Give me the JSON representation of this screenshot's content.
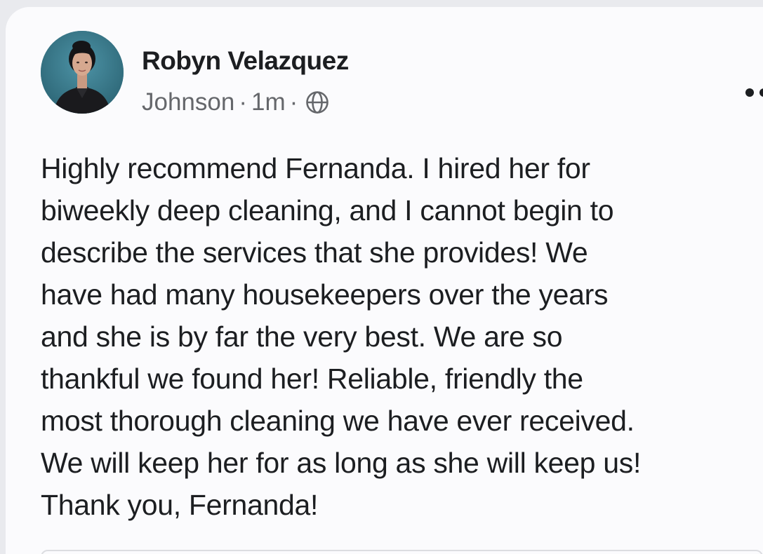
{
  "post": {
    "author": "Robyn Velazquez",
    "group": "Johnson",
    "separator": "·",
    "time": "1m",
    "privacy_icon": "globe-icon",
    "more_icon": "more-options-icon",
    "body_lines": [
      "Highly recommend Fernanda. I hired her for",
      "biweekly deep cleaning, and I cannot begin to",
      "describe the services that she provides! We",
      "have had many housekeepers over the years",
      "and she is by far the very best. We are so",
      "thankful we found her! Reliable, friendly the",
      "most thorough cleaning we have ever received.",
      "We will keep her for as long as she will keep us!",
      "Thank you, Fernanda!"
    ]
  },
  "colors": {
    "background": "#e9eaee",
    "card": "#fbfbfd",
    "text_primary": "#1c1e21",
    "text_secondary": "#65676b",
    "avatar_bg": "#3a7a8c"
  }
}
